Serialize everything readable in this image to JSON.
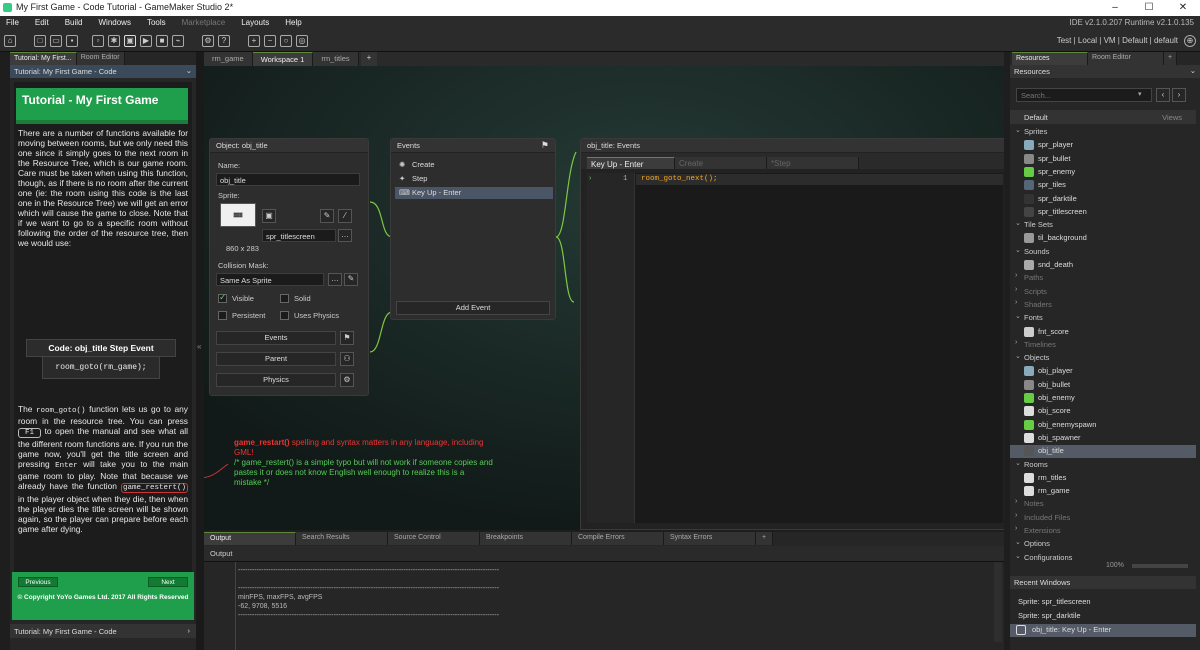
{
  "window": {
    "title": "My First Game - Code Tutorial - GameMaker Studio 2*"
  },
  "menu": {
    "items": [
      "File",
      "Edit",
      "Build",
      "Windows",
      "Tools",
      "Marketplace",
      "Layouts",
      "Help"
    ],
    "version": "IDE v2.1.0.207 Runtime v2.1.0.135"
  },
  "toolbar": {
    "target": "Test | Local | VM | Default | default"
  },
  "left_panel": {
    "tabs": [
      "Tutorial: My First...",
      "Room Editor"
    ],
    "panel_title": "Tutorial: My First Game - Code",
    "heading": "Tutorial - My First Game",
    "para1": "There are a number of functions available for moving between rooms, but we only need this one since it simply goes to the next room in the Resource Tree, which is our game room. Care must be taken when using this function, though, as if there is no room after the current one (ie: the room using this code is the last one in the Resource Tree) we will get an error which will cause the game to close. Note that if we want to go to a specific room without following the order of the resource tree, then we would use:",
    "code_label": "Code: obj_title Step Event",
    "code_line": "room_goto(rm_game);",
    "para2_a": "The",
    "para2_fn1": "room_goto()",
    "para2_b": "function lets us go to any room in the resource tree. You can press",
    "para2_key": "F1",
    "para2_c": "to open the manual and see what all the different room functions are. If you run the game now, you'll get the title screen and pressing",
    "para2_enter": "Enter",
    "para2_d": "will take you to the main game room to play. Note that because we already have the function",
    "para2_fn2": "game_restert()",
    "para2_e": "in the player object when they die, then when the player dies the title screen will be shown again, so the player can prepare before each game after dying.",
    "prev": "Previous",
    "next": "Next",
    "copyright": "© Copyright YoYo Games Ltd. 2017 All Rights Reserved",
    "footer": "Tutorial: My First Game - Code"
  },
  "workspace": {
    "tabs": [
      "rm_game",
      "Workspace 1",
      "rm_titles"
    ],
    "object_window": {
      "title": "Object: obj_title",
      "name_label": "Name:",
      "name_value": "obj_title",
      "sprite_label": "Sprite:",
      "sprite_value": "spr_titlescreen",
      "sprite_size": "860 x 283",
      "mask_label": "Collision Mask:",
      "mask_value": "Same As Sprite",
      "visible": "Visible",
      "solid": "Solid",
      "persistent": "Persistent",
      "uses_physics": "Uses Physics",
      "events_btn": "Events",
      "parent_btn": "Parent",
      "physics_btn": "Physics"
    },
    "events_window": {
      "title": "Events",
      "items": [
        "Create",
        "Step",
        "Key Up - Enter"
      ],
      "add": "Add Event"
    },
    "code_window": {
      "title": "obj_title: Events",
      "tabs": [
        "Key Up - Enter",
        "Create",
        "*Step"
      ],
      "line_no": "1",
      "code": "room_goto_next();"
    },
    "annotation": {
      "title": "game_restart()",
      "text": "spelling and syntax matters in any language, including GML!",
      "comment": "/* game_restert() is a simple typo but will not work if someone copies and pastes it or does not know English well enough to realize this is a mistake */"
    }
  },
  "output": {
    "tabs": [
      "Output",
      "Search Results",
      "Source Control",
      "Breakpoints",
      "Compile Errors",
      "Syntax Errors"
    ],
    "bar": "Output",
    "lines": [
      "----------------------------------------------------------------------------------------------------------------",
      "",
      "----------------------------------------------------------------------------------------------------------------",
      "minFPS, maxFPS, avgFPS",
      "-62, 9708, 5516",
      "----------------------------------------------------------------------------------------------------------------"
    ]
  },
  "resources": {
    "tabs": [
      "Resources",
      "Room Editor"
    ],
    "title": "Resources",
    "search_placeholder": "Search...",
    "default": "Default",
    "views": "Views",
    "zoom": "100%",
    "tree": [
      {
        "type": "group",
        "label": "Sprites"
      },
      {
        "type": "child",
        "label": "spr_player",
        "color": "#8ab"
      },
      {
        "type": "child",
        "label": "spr_bullet",
        "color": "#888"
      },
      {
        "type": "child",
        "label": "spr_enemy",
        "color": "#6c4"
      },
      {
        "type": "child",
        "label": "spr_tiles",
        "color": "#567"
      },
      {
        "type": "child",
        "label": "spr_darktile",
        "color": "#333"
      },
      {
        "type": "child",
        "label": "spr_titlescreen",
        "color": "#444"
      },
      {
        "type": "group",
        "label": "Tile Sets"
      },
      {
        "type": "child",
        "label": "til_background",
        "color": "#999"
      },
      {
        "type": "group",
        "label": "Sounds"
      },
      {
        "type": "child",
        "label": "snd_death",
        "color": "#aaa"
      },
      {
        "type": "group-dim",
        "label": "Paths"
      },
      {
        "type": "group-dim",
        "label": "Scripts"
      },
      {
        "type": "group-dim",
        "label": "Shaders"
      },
      {
        "type": "group",
        "label": "Fonts"
      },
      {
        "type": "child",
        "label": "fnt_score",
        "color": "#ccc"
      },
      {
        "type": "group-dim",
        "label": "Timelines"
      },
      {
        "type": "group",
        "label": "Objects"
      },
      {
        "type": "child",
        "label": "obj_player",
        "color": "#8ab"
      },
      {
        "type": "child",
        "label": "obj_bullet",
        "color": "#888"
      },
      {
        "type": "child",
        "label": "obj_enemy",
        "color": "#6c4"
      },
      {
        "type": "child",
        "label": "obj_score",
        "color": "#ddd"
      },
      {
        "type": "child",
        "label": "obj_enemyspawn",
        "color": "#6c4"
      },
      {
        "type": "child",
        "label": "obj_spawner",
        "color": "#ddd"
      },
      {
        "type": "child-sel",
        "label": "obj_title",
        "color": "#555"
      },
      {
        "type": "group",
        "label": "Rooms"
      },
      {
        "type": "child",
        "label": "rm_titles",
        "color": "#ddd"
      },
      {
        "type": "child",
        "label": "rm_game",
        "color": "#ddd"
      },
      {
        "type": "group-dim",
        "label": "Notes"
      },
      {
        "type": "group-dim",
        "label": "Included Files"
      },
      {
        "type": "group-dim",
        "label": "Extensions"
      },
      {
        "type": "group",
        "label": "Options"
      },
      {
        "type": "group",
        "label": "Configurations"
      }
    ],
    "recent_title": "Recent Windows",
    "recent": [
      "Sprite: spr_titlescreen",
      "Sprite: spr_darktile",
      "obj_title: Key Up - Enter"
    ]
  }
}
